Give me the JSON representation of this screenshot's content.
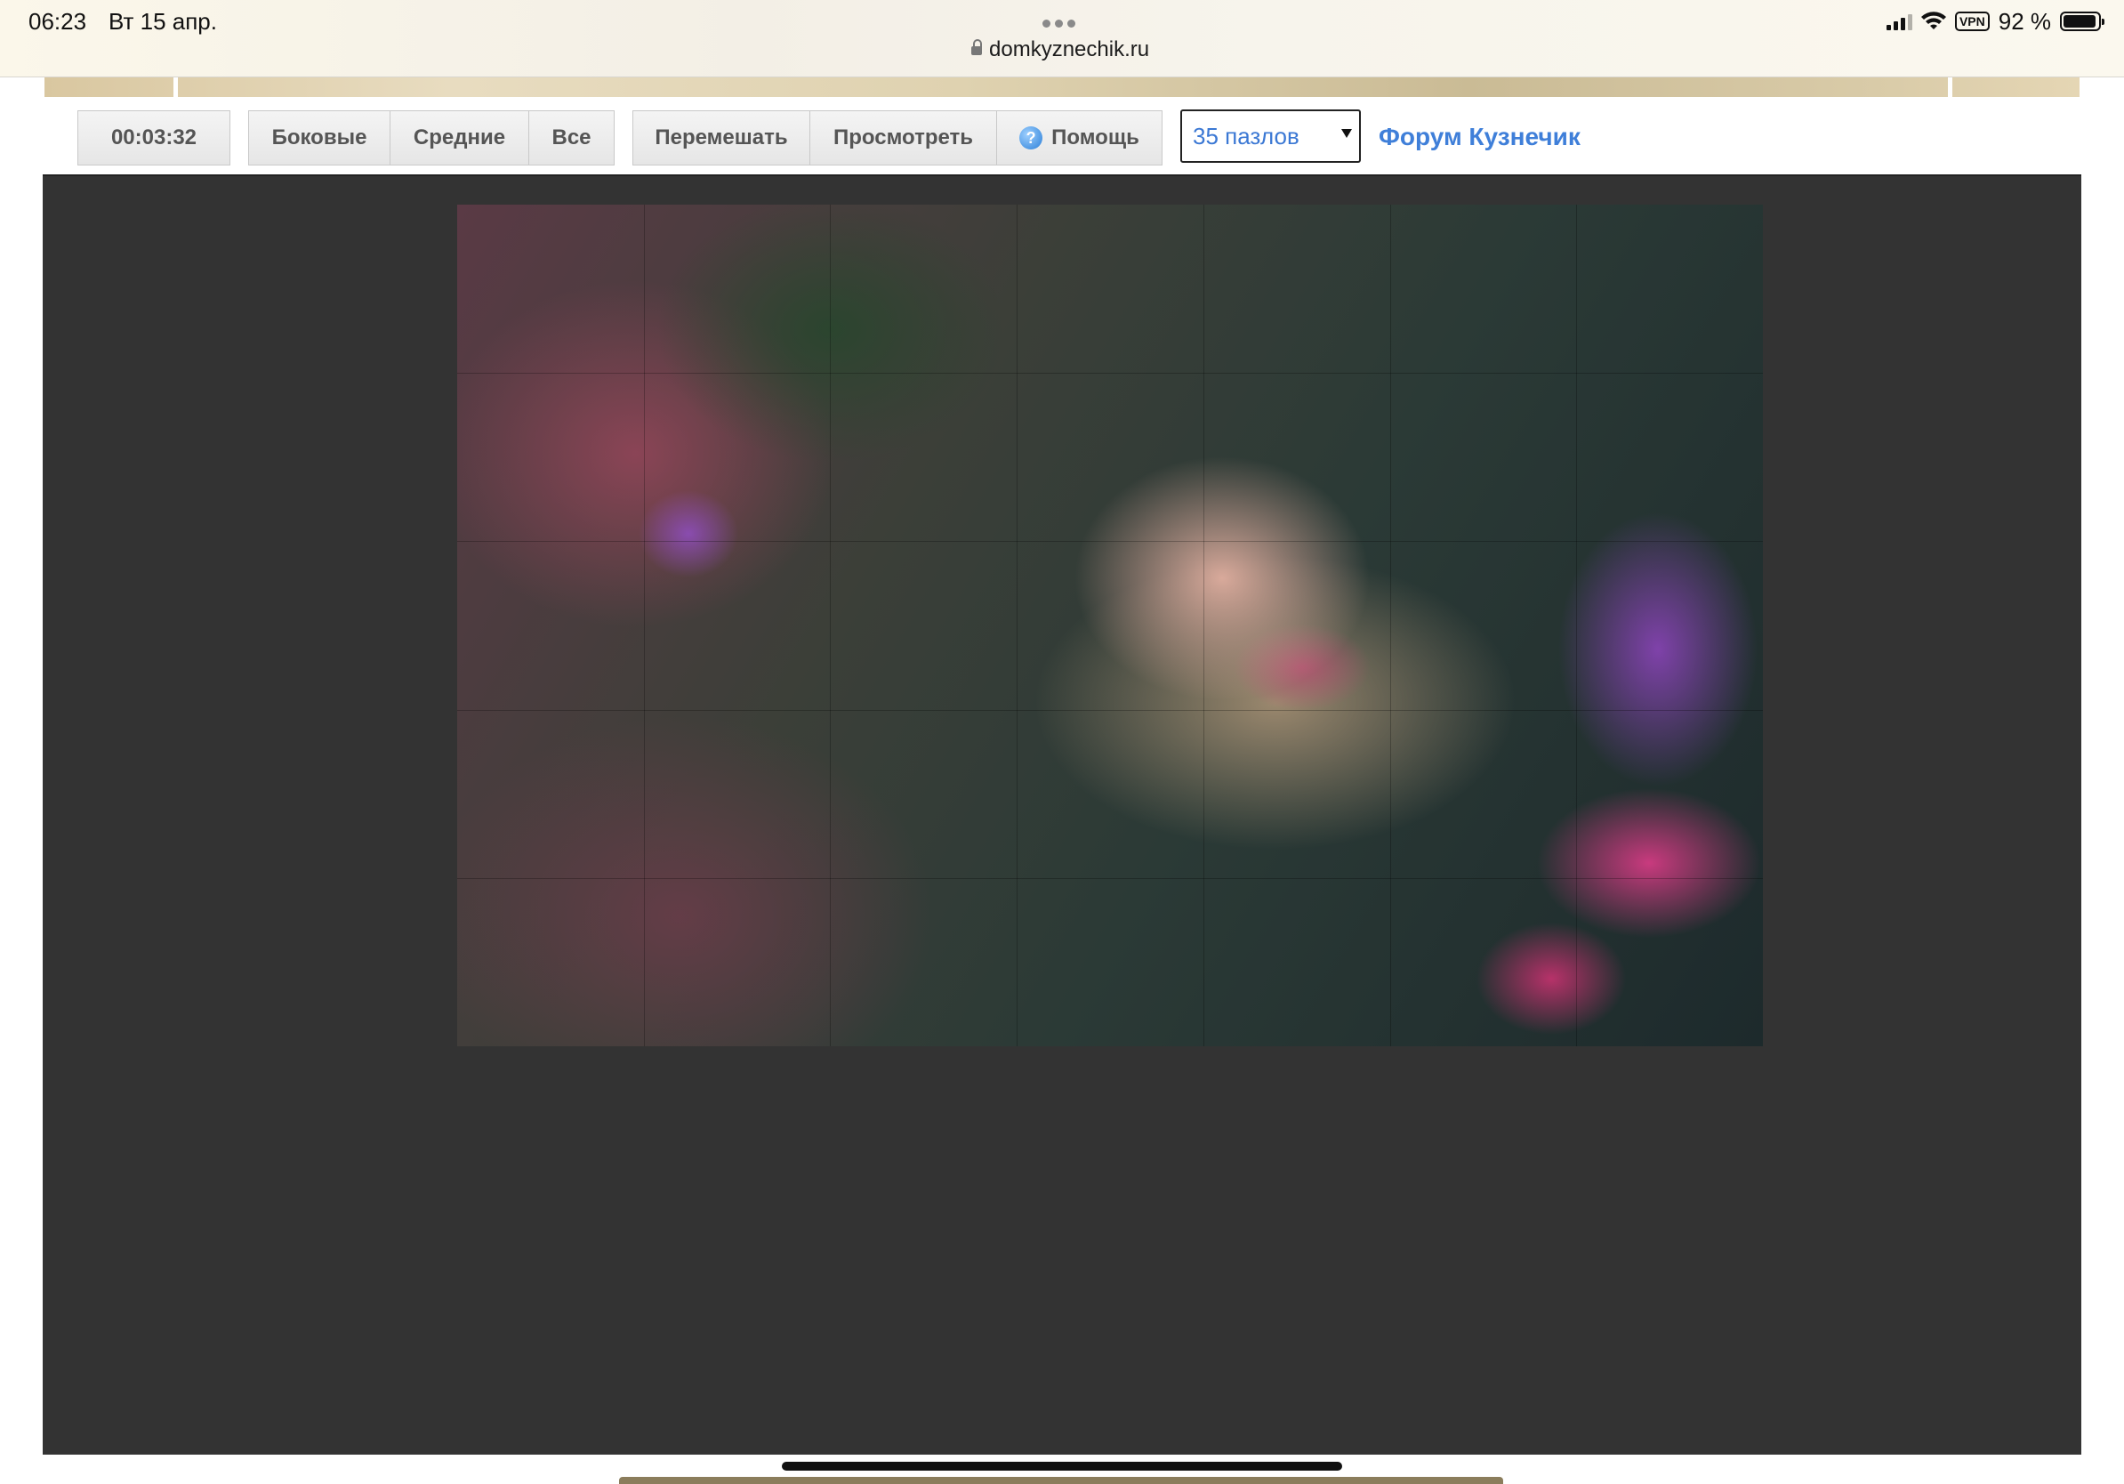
{
  "status_bar": {
    "time": "06:23",
    "date": "Вт 15 апр.",
    "url": "domkyznechik.ru",
    "vpn": "VPN",
    "battery": "92 %"
  },
  "toolbar": {
    "timer": "00:03:32",
    "filter_buttons": [
      "Боковые",
      "Средние",
      "Все"
    ],
    "action_buttons": {
      "shuffle": "Перемешать",
      "preview": "Просмотреть",
      "help": "Помощь",
      "help_icon": "?"
    },
    "pieces_select": {
      "value": "35 пазлов"
    },
    "forum_link": "Форум Кузнечик"
  },
  "puzzle": {
    "rows": 5,
    "columns": 7,
    "image_description": "woman with pink eye makeup lying among purple and pink wildflowers and green grass"
  }
}
